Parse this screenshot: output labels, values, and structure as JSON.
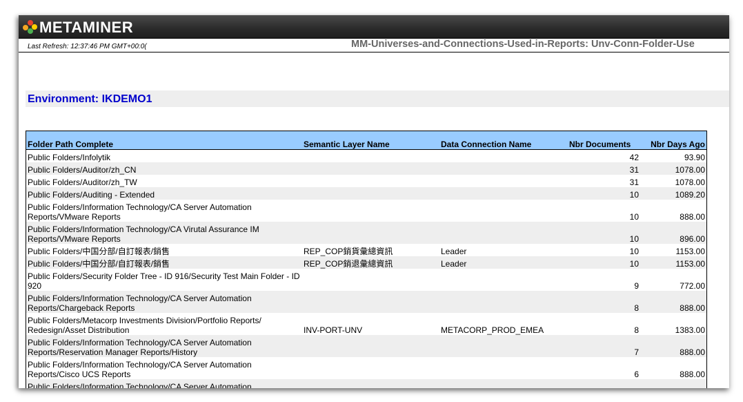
{
  "brand": {
    "name": "Metaminer"
  },
  "header": {
    "last_refresh": "Last Refresh: 12:37:46 PM GMT+00:0(",
    "report_name": "MM-Universes-and-Connections-Used-in-Reports: Unv-Conn-Folder-Use"
  },
  "environment": {
    "title": "Environment: IKDEMO1"
  },
  "colors": {
    "header_bar": "#2a2a2a",
    "column_header_bg": "#99ccff",
    "environment_text": "#0000cc",
    "row_alt_bg": "#eeeeee"
  },
  "table": {
    "columns": [
      "Folder Path Complete",
      "Semantic Layer Name",
      "Data Connection Name",
      "Nbr Documents",
      "Nbr Days Ago"
    ],
    "rows": [
      [
        "Public Folders/Infolytik",
        "",
        "",
        "42",
        "93.90"
      ],
      [
        "Public Folders/Auditor/zh_CN",
        "",
        "",
        "31",
        "1078.00"
      ],
      [
        "Public Folders/Auditor/zh_TW",
        "",
        "",
        "31",
        "1078.00"
      ],
      [
        "Public Folders/Auditing - Extended",
        "",
        "",
        "10",
        "1089.20"
      ],
      [
        "Public Folders/Information Technology/CA Server Automation Reports/VMware Reports",
        "",
        "",
        "10",
        "888.00"
      ],
      [
        "Public Folders/Information Technology/CA Virutal Assurance IM Reports/VMware Reports",
        "",
        "",
        "10",
        "896.00"
      ],
      [
        "Public Folders/中国分部/自訂報表/銷售",
        "REP_COP銷貨彙總資訊",
        "Leader",
        "10",
        "1153.00"
      ],
      [
        "Public Folders/中国分部/自訂報表/銷售",
        "REP_COP銷退彙總資訊",
        "Leader",
        "10",
        "1153.00"
      ],
      [
        "Public Folders/Security Folder Tree - ID 916/Security Test Main Folder - ID 920",
        "",
        "",
        "9",
        "772.00"
      ],
      [
        "Public Folders/Information Technology/CA Server Automation Reports/Chargeback Reports",
        "",
        "",
        "8",
        "888.00"
      ],
      [
        "Public Folders/Metacorp Investments Division/Portfolio Reports/ Redesign/Asset Distribution",
        "INV-PORT-UNV",
        "METACORP_PROD_EMEA",
        "8",
        "1383.00"
      ],
      [
        "Public Folders/Information Technology/CA Server Automation Reports/Reservation Manager Reports/History",
        "",
        "",
        "7",
        "888.00"
      ],
      [
        "Public Folders/Information Technology/CA Server Automation Reports/Cisco UCS Reports",
        "",
        "",
        "6",
        "888.00"
      ],
      [
        "Public Folders/Information Technology/CA Server Automation",
        "",
        "",
        "",
        ""
      ]
    ]
  }
}
